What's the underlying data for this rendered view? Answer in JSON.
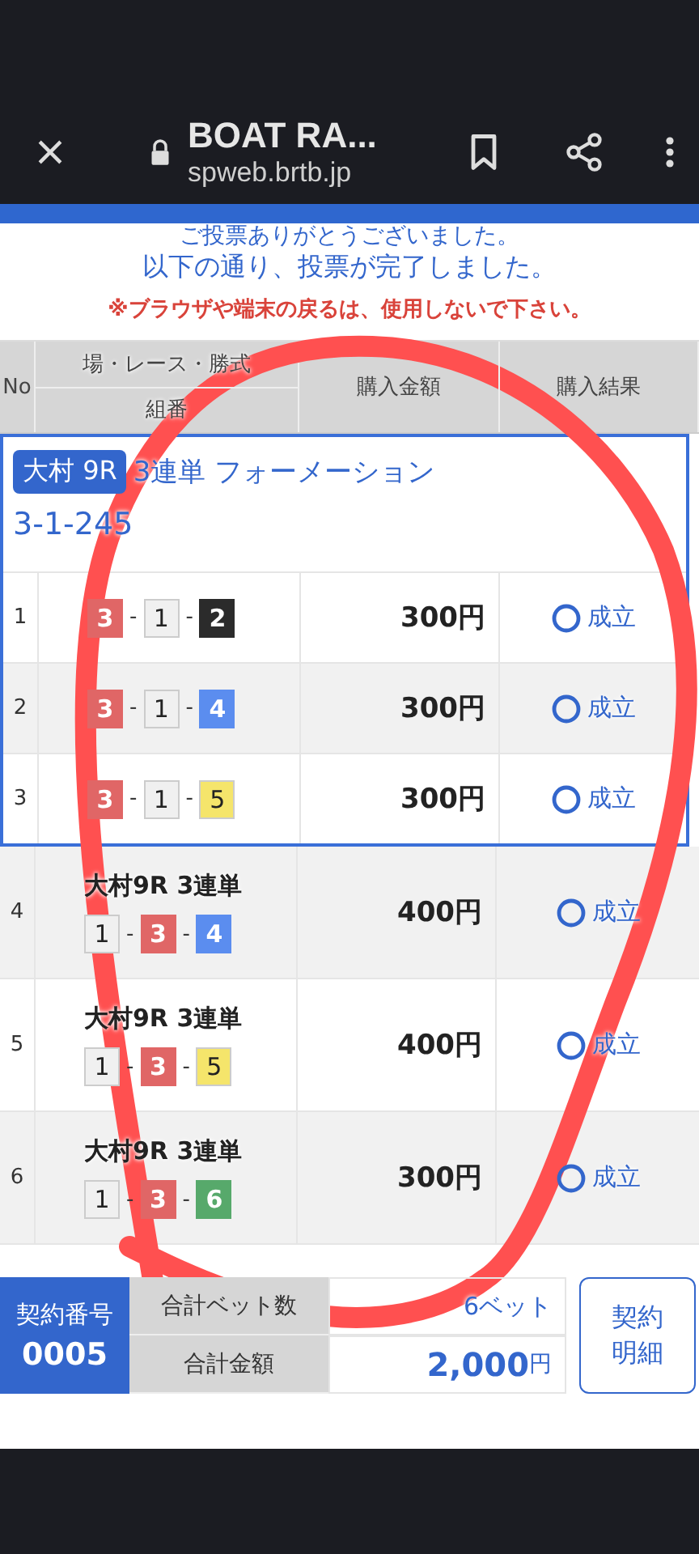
{
  "browser": {
    "title": "BOAT RA...",
    "url": "spweb.brtb.jp"
  },
  "messages": {
    "thanks": "ご投票ありがとうございました。",
    "complete": "以下の通り、投票が完了しました。",
    "warning": "※ブラウザや端末の戻るは、使用しないで下さい。"
  },
  "table": {
    "columns": {
      "no": "No",
      "place": "場・レース・勝式",
      "combo": "組番",
      "amount": "購入金額",
      "result": "購入結果"
    },
    "formation": {
      "badge": "大村 9R",
      "title": "3連単 フォーメーション",
      "combo": "3-1-245",
      "rows": [
        {
          "no": "1",
          "boats": [
            {
              "num": "3",
              "color": "#e06666"
            },
            {
              "sep": "-",
              "num": "1",
              "color": "#f0f0f0"
            },
            {
              "sep": "-",
              "num": "2",
              "color": "#2b2b2b"
            }
          ],
          "amount": "300円",
          "result": "成立"
        },
        {
          "no": "2",
          "boats": [
            {
              "num": "3",
              "color": "#e06666"
            },
            {
              "sep": "-",
              "num": "1",
              "color": "#f0f0f0"
            },
            {
              "sep": "-",
              "num": "4",
              "color": "#5b8def"
            }
          ],
          "amount": "300円",
          "result": "成立"
        },
        {
          "no": "3",
          "boats": [
            {
              "num": "3",
              "color": "#e06666"
            },
            {
              "sep": "-",
              "num": "1",
              "color": "#f0f0f0"
            },
            {
              "sep": "-",
              "num": "5",
              "color": "#f5e56b"
            }
          ],
          "amount": "300円",
          "result": "成立"
        }
      ]
    },
    "rows": [
      {
        "no": "4",
        "race": "大村9R 3連単",
        "boats": [
          {
            "num": "1",
            "color": "#f0f0f0"
          },
          {
            "sep": "-",
            "num": "3",
            "color": "#e06666"
          },
          {
            "sep": "-",
            "num": "4",
            "color": "#5b8def"
          }
        ],
        "amount": "400円",
        "result": "成立"
      },
      {
        "no": "5",
        "race": "大村9R 3連単",
        "boats": [
          {
            "num": "1",
            "color": "#f0f0f0"
          },
          {
            "sep": "-",
            "num": "3",
            "color": "#e06666"
          },
          {
            "sep": "-",
            "num": "5",
            "color": "#f5e56b"
          }
        ],
        "amount": "400円",
        "result": "成立"
      },
      {
        "no": "6",
        "race": "大村9R 3連単",
        "boats": [
          {
            "num": "1",
            "color": "#f0f0f0"
          },
          {
            "sep": "-",
            "num": "3",
            "color": "#e06666"
          },
          {
            "sep": "-",
            "num": "6",
            "color": "#57a96b"
          }
        ],
        "amount": "300円",
        "result": "成立"
      }
    ]
  },
  "summary": {
    "contract_label": "契約番号",
    "contract_number": "0005",
    "bet_count_label": "合計ベット数",
    "bet_count": "6ベット",
    "total_label": "合計金額",
    "total": "2,000",
    "total_unit": "円",
    "details_button": "契約明細"
  }
}
